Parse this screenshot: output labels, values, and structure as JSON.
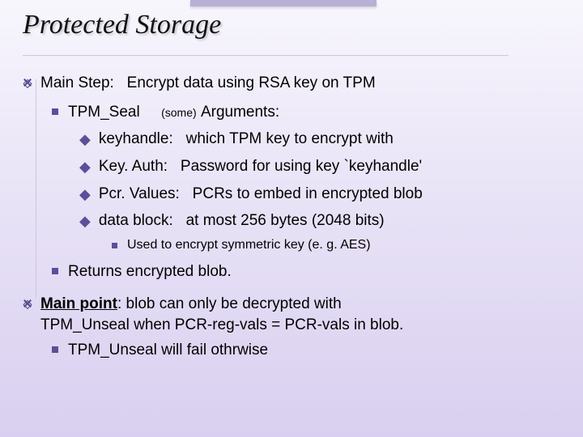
{
  "title": "Protected Storage",
  "main_step": {
    "label": "Main Step:",
    "text": "Encrypt data using RSA key on TPM"
  },
  "seal": {
    "name": "TPM_Seal",
    "some": "(some)",
    "args_label": "Arguments:",
    "args": [
      {
        "k": "keyhandle:",
        "v": "which TPM key to encrypt with"
      },
      {
        "k": "Key. Auth:",
        "v": "Password for using key `keyhandle'"
      },
      {
        "k": "Pcr. Values:",
        "v": "PCRs to embed in encrypted blob"
      },
      {
        "k": "data block:",
        "v": "at most 256 bytes  (2048 bits)"
      }
    ],
    "note": "Used to encrypt symmetric key (e. g. AES)",
    "returns": "Returns encrypted blob."
  },
  "main_point": {
    "label": "Main point",
    "text1": ":   blob can only be decrypted with",
    "text2": "TPM_Unseal when  PCR-reg-vals = PCR-vals  in blob.",
    "sub": "TPM_Unseal will fail othrwise"
  }
}
